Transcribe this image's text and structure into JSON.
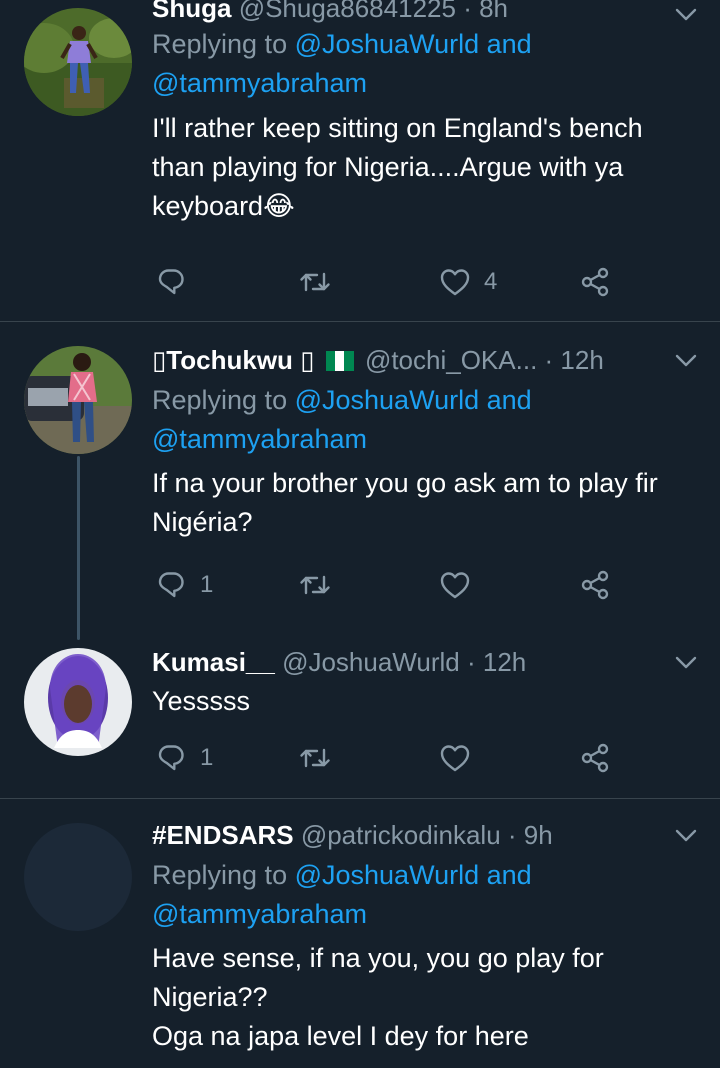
{
  "tweets": [
    {
      "name": "Shuga",
      "handle": "@Shuga86841225",
      "time": "· 8h",
      "reply_prefix": "Replying to ",
      "reply_mention1": "@JoshuaWurld",
      "reply_and": " and",
      "reply_mention2": "@tammyabraham",
      "text": "I'll rather keep sitting on England's bench than playing for Nigeria....Argue with ya keyboard😂",
      "reply_count": "",
      "retweet_count": "",
      "like_count": "4"
    },
    {
      "name": "▯Tochukwu ▯",
      "handle": "@tochi_OKA...",
      "time": "· 12h",
      "reply_prefix": "Replying to ",
      "reply_mention1": "@JoshuaWurld",
      "reply_and": " and",
      "reply_mention2": "@tammyabraham",
      "text": "If na your brother you go ask am to play fir Nigéria?",
      "reply_count": "1",
      "retweet_count": "",
      "like_count": ""
    },
    {
      "name": "Kumasi__",
      "handle": "@JoshuaWurld",
      "time": "· 12h",
      "text": "Yesssss",
      "reply_count": "1",
      "retweet_count": "",
      "like_count": ""
    },
    {
      "name": "#ENDSARS",
      "handle": "@patrickodinkalu",
      "time": "· 9h",
      "reply_prefix": "Replying to ",
      "reply_mention1": "@JoshuaWurld",
      "reply_and": " and",
      "reply_mention2": "@tammyabraham",
      "text_line1": "Have sense, if na you, you go play for Nigeria??",
      "text_line2": "Oga na japa level I dey for here"
    }
  ],
  "colors": {
    "background": "#15202b",
    "divider": "#38444d",
    "secondary_text": "#8899a6",
    "mention": "#1da1f2",
    "flag_green": "#008751"
  },
  "icons": [
    "reply-icon",
    "retweet-icon",
    "like-icon",
    "share-icon",
    "chevron-down-icon",
    "nigeria-flag-icon"
  ]
}
